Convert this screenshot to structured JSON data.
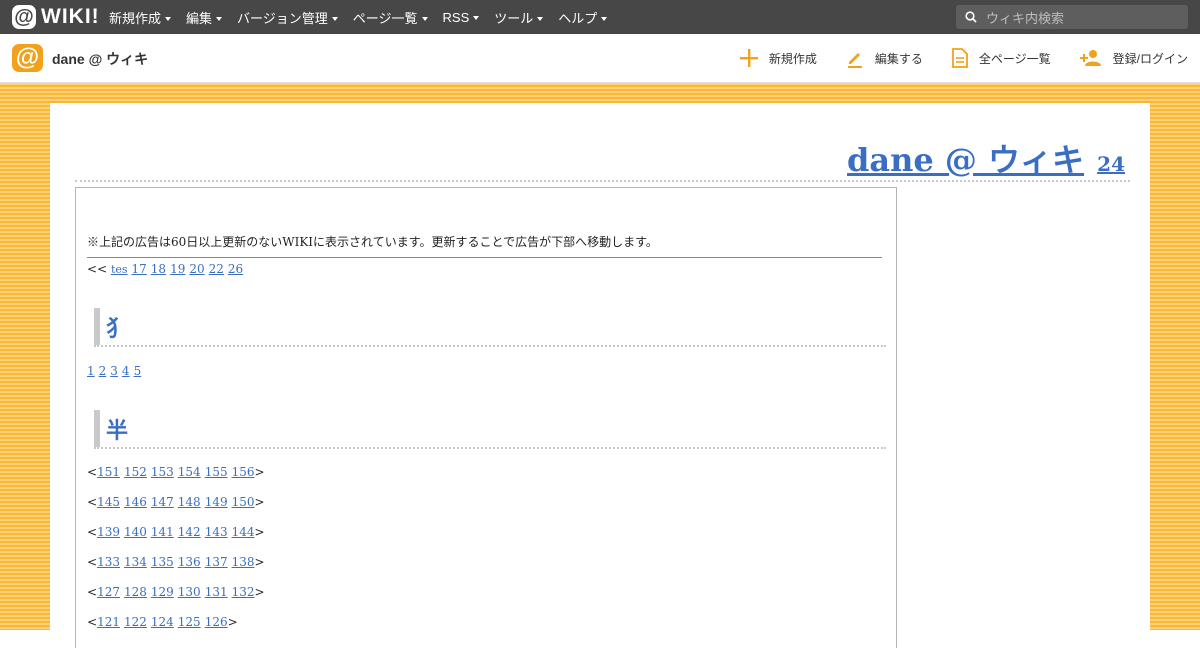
{
  "topbar": {
    "logo_text": "WIKI!",
    "nav": [
      {
        "label": "新規作成"
      },
      {
        "label": "編集"
      },
      {
        "label": "バージョン管理"
      },
      {
        "label": "ページ一覧"
      },
      {
        "label": "RSS"
      },
      {
        "label": "ツール"
      },
      {
        "label": "ヘルプ"
      }
    ],
    "search_placeholder": "ウィキ内検索"
  },
  "sitebar": {
    "site_name": "dane @ ウィキ",
    "actions": [
      {
        "label": "新規作成",
        "icon": "plus-icon"
      },
      {
        "label": "編集する",
        "icon": "pencil-icon"
      },
      {
        "label": "全ページ一覧",
        "icon": "page-list-icon"
      },
      {
        "label": "登録/ログイン",
        "icon": "user-add-icon"
      }
    ],
    "accent": "#f2a11b"
  },
  "page": {
    "title": "dane @ ウィキ",
    "count": "24",
    "notice": "※上記の広告は60日以上更新のないWIKIに表示されています。更新することで広告が下部へ移動します。",
    "nav_prefix": "<<",
    "nav_links": [
      "tes",
      "17",
      "18",
      "19",
      "20",
      "22",
      "26"
    ],
    "sections": [
      {
        "heading": "犭",
        "lines": [
          {
            "prefix": "",
            "links": [
              "1",
              "2",
              "3",
              "4",
              "5"
            ],
            "suffix": ""
          }
        ]
      },
      {
        "heading": "半",
        "lines": [
          {
            "prefix": "<",
            "links": [
              "151",
              "152",
              "153",
              "154",
              "155",
              "156"
            ],
            "suffix": ">"
          },
          {
            "prefix": "<",
            "links": [
              "145",
              "146",
              "147",
              "148",
              "149",
              "150"
            ],
            "suffix": ">"
          },
          {
            "prefix": "<",
            "links": [
              "139",
              "140",
              "141",
              "142",
              "143",
              "144"
            ],
            "suffix": ">"
          },
          {
            "prefix": "<",
            "links": [
              "133",
              "134",
              "135",
              "136",
              "137",
              "138"
            ],
            "suffix": ">"
          },
          {
            "prefix": "<",
            "links": [
              "127",
              "128",
              "129",
              "130",
              "131",
              "132"
            ],
            "suffix": ">"
          },
          {
            "prefix": "<",
            "links": [
              "121",
              "122",
              "124",
              "125",
              "126"
            ],
            "suffix": ">"
          }
        ]
      }
    ],
    "link_color": "#3a6ec3"
  }
}
